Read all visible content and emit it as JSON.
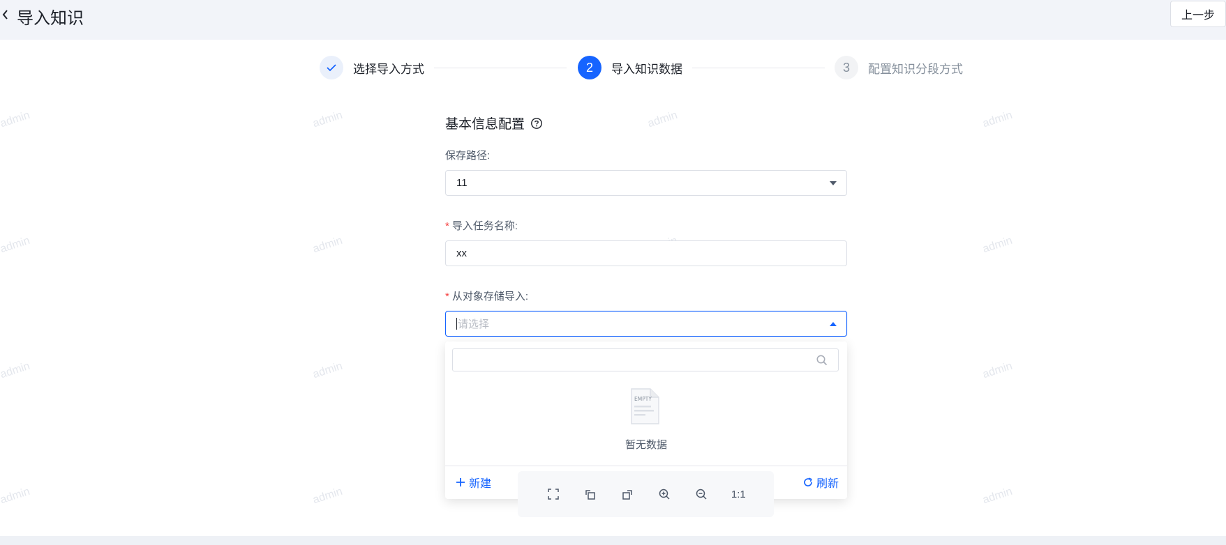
{
  "header": {
    "title": "导入知识",
    "prev_button": "上一步"
  },
  "steps": [
    {
      "number": "1",
      "label": "选择导入方式",
      "status": "done"
    },
    {
      "number": "2",
      "label": "导入知识数据",
      "status": "active"
    },
    {
      "number": "3",
      "label": "配置知识分段方式",
      "status": "pending"
    }
  ],
  "form": {
    "section_title": "基本信息配置",
    "save_path": {
      "label": "保存路径:",
      "value": "11"
    },
    "task_name": {
      "label": "导入任务名称:",
      "value": "xx",
      "required": true
    },
    "object_storage": {
      "label": "从对象存储导入:",
      "placeholder": "请选择",
      "required": true
    }
  },
  "dropdown": {
    "search_placeholder": "",
    "empty_icon_text": "EMPTY",
    "empty_text": "暂无数据",
    "new_label": "新建",
    "refresh_label": "刷新"
  },
  "viewer_toolbar": {
    "actual_size_label": "1:1",
    "icons": [
      "fullscreen-icon",
      "rotate-left-icon",
      "rotate-right-icon",
      "zoom-in-icon",
      "zoom-out-icon"
    ]
  },
  "watermark": "admin",
  "colors": {
    "primary": "#1664ff",
    "required": "#f53f3f",
    "background": "#eef1f6"
  }
}
